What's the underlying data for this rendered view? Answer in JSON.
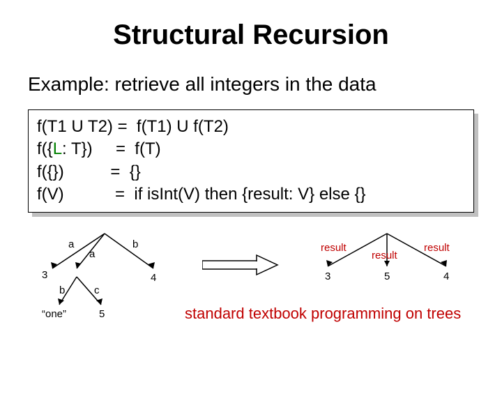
{
  "title": "Structural Recursion",
  "subtitle": "Example: retrieve all integers in the data",
  "code": {
    "r1a": "f(T1 U T2) =  f(T1) U f(T2)",
    "r2a": "f({",
    "r2L": "L",
    "r2b": ": T})     =  f(T)",
    "r3a": "f({})          =  {}",
    "r4a": "f(V)           =  if isInt(V) then {result: V} else {}"
  },
  "leftTree": {
    "edges": {
      "a1": "a",
      "a2": "a",
      "b1": "b",
      "bL": "b",
      "cL": "c"
    },
    "leaves": {
      "n3": "3",
      "n4": "4",
      "one": "“one”",
      "n5": "5"
    }
  },
  "rightTree": {
    "edges": {
      "r1": "result",
      "r2": "result",
      "r3": "result"
    },
    "leaves": {
      "v1": "3",
      "v2": "5",
      "v3": "4"
    }
  },
  "caption": "standard textbook programming on trees"
}
